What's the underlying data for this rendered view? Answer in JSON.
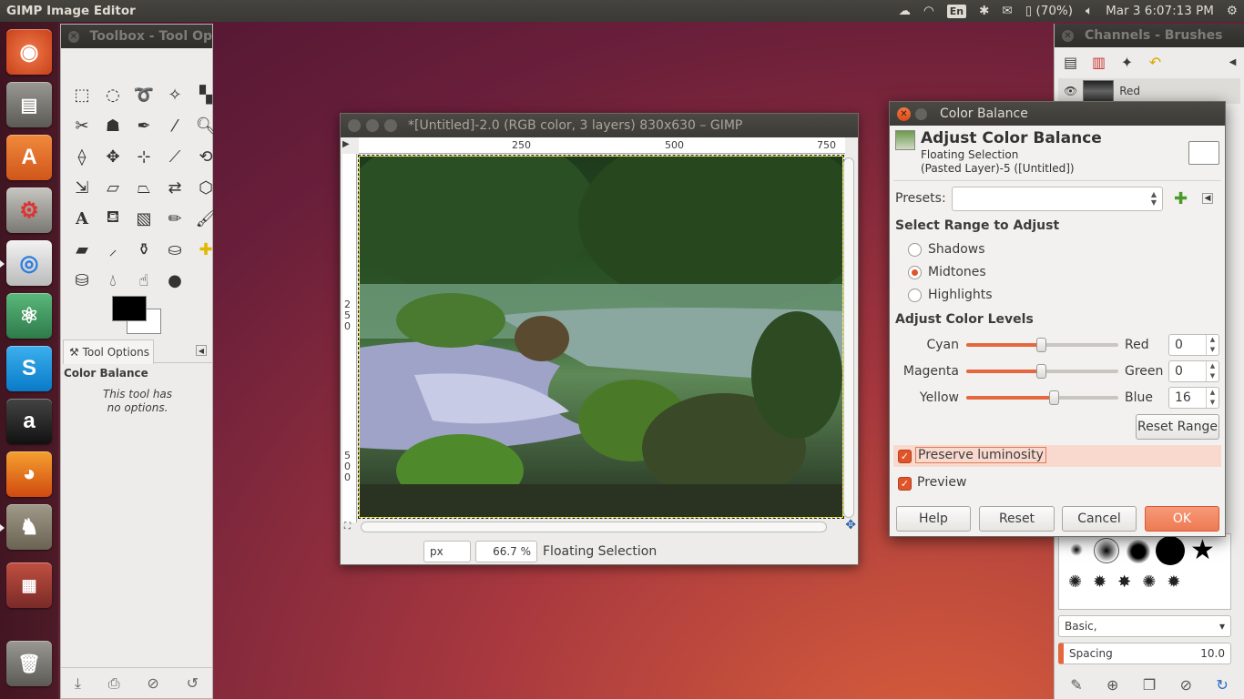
{
  "topbar": {
    "title": "GIMP Image Editor",
    "keyboard": "En",
    "battery": "(70%)",
    "datetime": "Mar  3  6:07:13 PM"
  },
  "launcher": {
    "items": [
      "ubuntu-dash",
      "files",
      "software-center",
      "system-settings",
      "chrome",
      "atom",
      "skype",
      "amazon",
      "firefox",
      "gimp",
      "workspaces",
      "trash"
    ]
  },
  "toolbox": {
    "title": "Toolbox - Tool Op",
    "tab_label": "Tool Options",
    "tool_name": "Color Balance",
    "note_line1": "This tool has",
    "note_line2": "no options."
  },
  "image_window": {
    "title": "*[Untitled]-2.0 (RGB color, 3 layers) 830x630 – GIMP",
    "ruler_h": [
      "250",
      "500",
      "750"
    ],
    "ruler_v": [
      "250",
      "500"
    ],
    "unit": "px",
    "zoom": "66.7 %",
    "status": "Floating Selection"
  },
  "dock": {
    "title": "Channels - Brushes",
    "channel_name": "Red",
    "brush_set": "Basic,",
    "spacing_label": "Spacing",
    "spacing_value": "10.0"
  },
  "dialog": {
    "title": "Color Balance",
    "header": "Adjust Color Balance",
    "sub1": "Floating Selection",
    "sub2": "(Pasted Layer)-5 ([Untitled])",
    "presets_label": "Presets:",
    "range_heading": "Select Range to Adjust",
    "ranges": [
      "Shadows",
      "Midtones",
      "Highlights"
    ],
    "selected_range": "Midtones",
    "levels_heading": "Adjust Color Levels",
    "levels": [
      {
        "left": "Cyan",
        "right": "Red",
        "value": "0"
      },
      {
        "left": "Magenta",
        "right": "Green",
        "value": "0"
      },
      {
        "left": "Yellow",
        "right": "Blue",
        "value": "16"
      }
    ],
    "reset_range": "Reset Range",
    "preserve_label": "Preserve luminosity",
    "preview_label": "Preview",
    "buttons": {
      "help": "Help",
      "reset": "Reset",
      "cancel": "Cancel",
      "ok": "OK"
    },
    "accent": "#e0542a"
  }
}
